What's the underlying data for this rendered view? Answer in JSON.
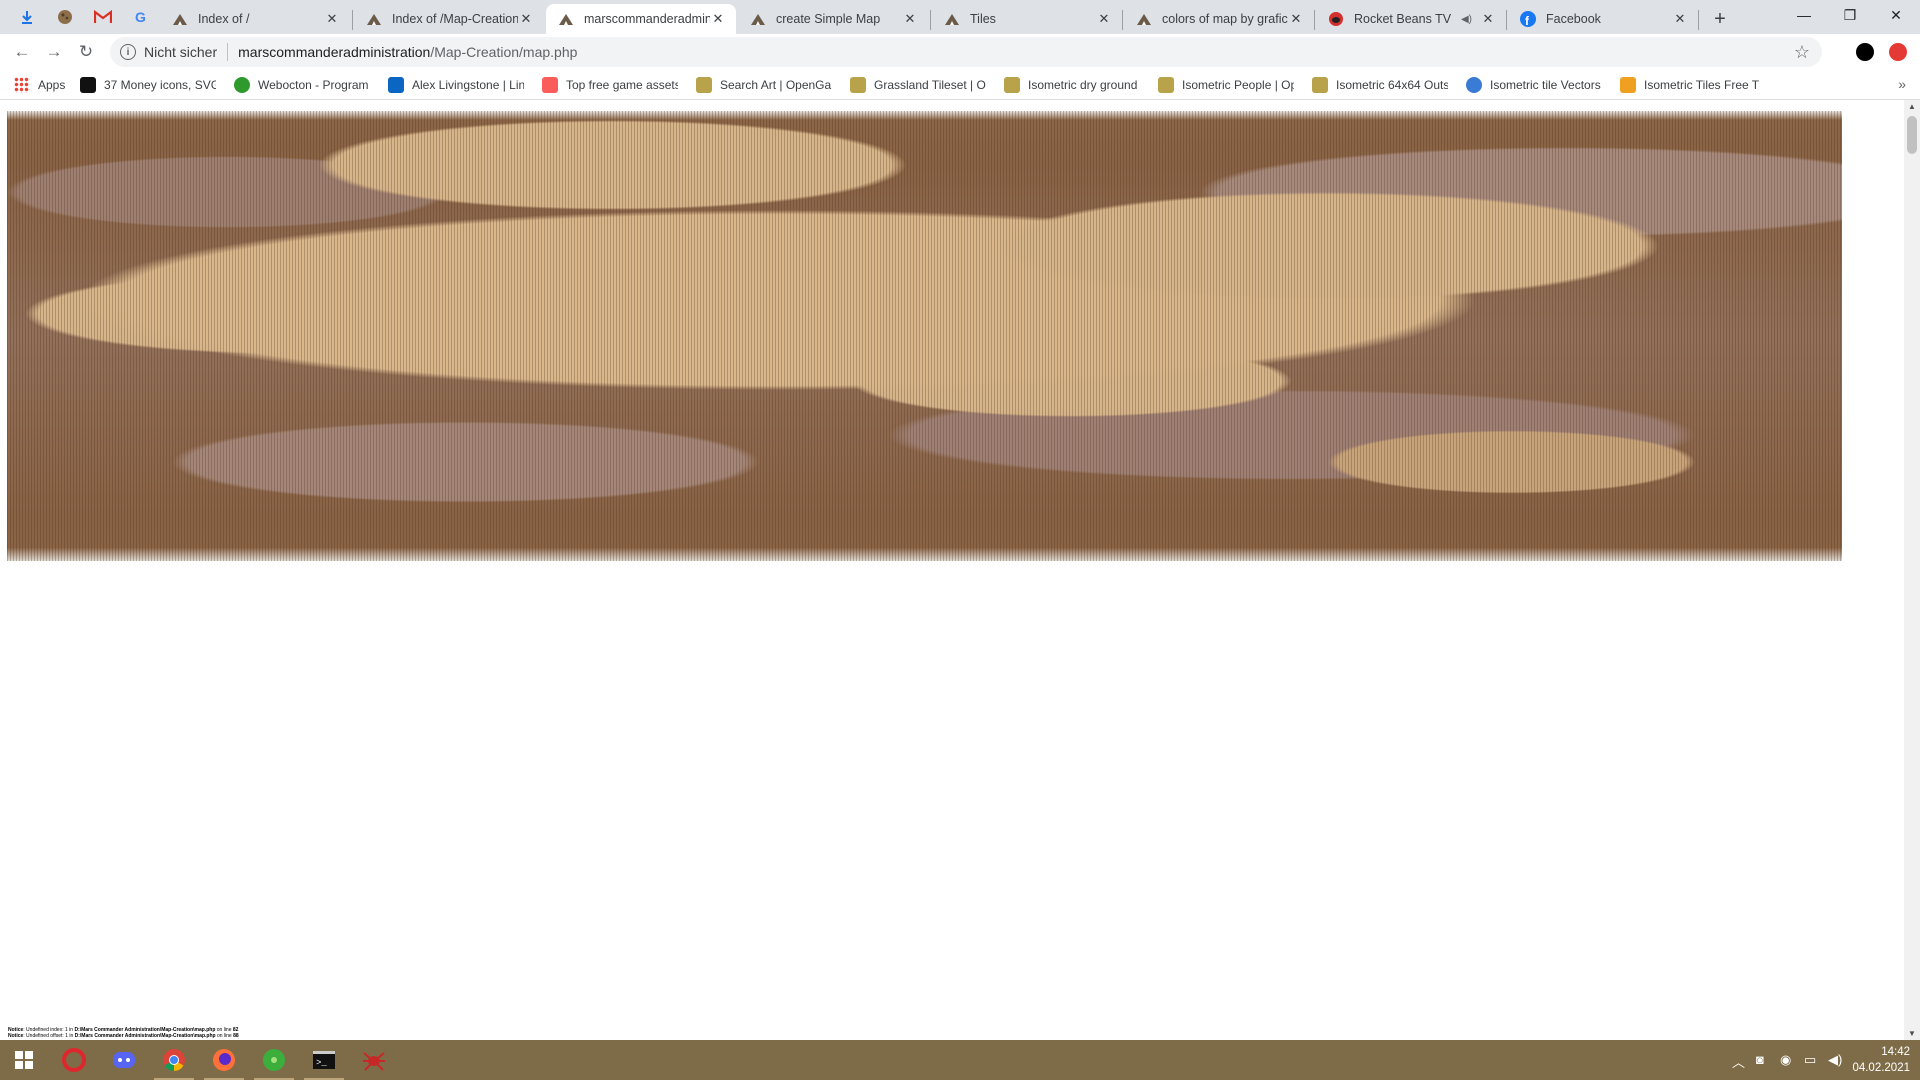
{
  "browser": {
    "tabs": [
      {
        "title": "Index of /",
        "icon": "tent-icon",
        "active": false
      },
      {
        "title": "Index of /Map-Creation",
        "icon": "tent-icon",
        "active": false
      },
      {
        "title": "marscommanderadmini",
        "icon": "tent-icon",
        "active": true
      },
      {
        "title": "create Simple Map",
        "icon": "tent-icon",
        "active": false
      },
      {
        "title": "Tiles",
        "icon": "tent-icon",
        "active": false
      },
      {
        "title": "colors of map by grafic",
        "icon": "tent-icon",
        "active": false
      },
      {
        "title": "Rocket Beans TV",
        "icon": "rocket-beans-icon",
        "active": false,
        "muted": true
      },
      {
        "title": "Facebook",
        "icon": "facebook-icon",
        "active": false
      }
    ],
    "security_label": "Nicht sicher",
    "url_host": "marscommanderadministration",
    "url_path": "/Map-Creation/map.php",
    "bookmarks": [
      {
        "label": "Apps",
        "icon": "apps-grid-icon"
      },
      {
        "label": "37 Money icons, SVG",
        "icon": "black-square-icon"
      },
      {
        "label": "Webocton - Program",
        "icon": "green-circle-icon"
      },
      {
        "label": "Alex Livingstone | Lin",
        "icon": "linkedin-icon"
      },
      {
        "label": "Top free game assets",
        "icon": "itch-icon"
      },
      {
        "label": "Search Art | OpenGa",
        "icon": "opengameart-icon"
      },
      {
        "label": "Grassland Tileset | O",
        "icon": "opengameart-icon"
      },
      {
        "label": "Isometric dry ground",
        "icon": "opengameart-icon"
      },
      {
        "label": "Isometric People | Op",
        "icon": "opengameart-icon"
      },
      {
        "label": "Isometric 64x64 Outs",
        "icon": "opengameart-icon"
      },
      {
        "label": "Isometric tile Vectors",
        "icon": "vector-icon"
      },
      {
        "label": "Isometric Tiles Free T",
        "icon": "craftpix-icon"
      }
    ],
    "more_bookmarks": "»"
  },
  "page": {
    "notices": [
      {
        "prefix": "Notice",
        "text": ": Undefined index: 1 in ",
        "path": "D:\\Mars Commander Administration\\Map-Creation\\map.php",
        "suffix": " on line ",
        "line": "82"
      },
      {
        "prefix": "Notice",
        "text": ": Undefined offset: 1 in ",
        "path": "D:\\Mars Commander Administration\\Map-Creation\\map.php",
        "suffix": " on line ",
        "line": "88"
      }
    ]
  },
  "taskbar": {
    "apps": [
      "start-icon",
      "opera-icon",
      "discord-icon",
      "chrome-icon",
      "firefox-icon",
      "green-app-icon",
      "terminal-icon",
      "spider-icon"
    ],
    "time": "14:42",
    "date": "04.02.2021"
  },
  "colors": {
    "map_light": "#d7b58a",
    "map_dark": "#8a6345",
    "map_mauve": "#a58678",
    "taskbar": "#7e6c48"
  }
}
